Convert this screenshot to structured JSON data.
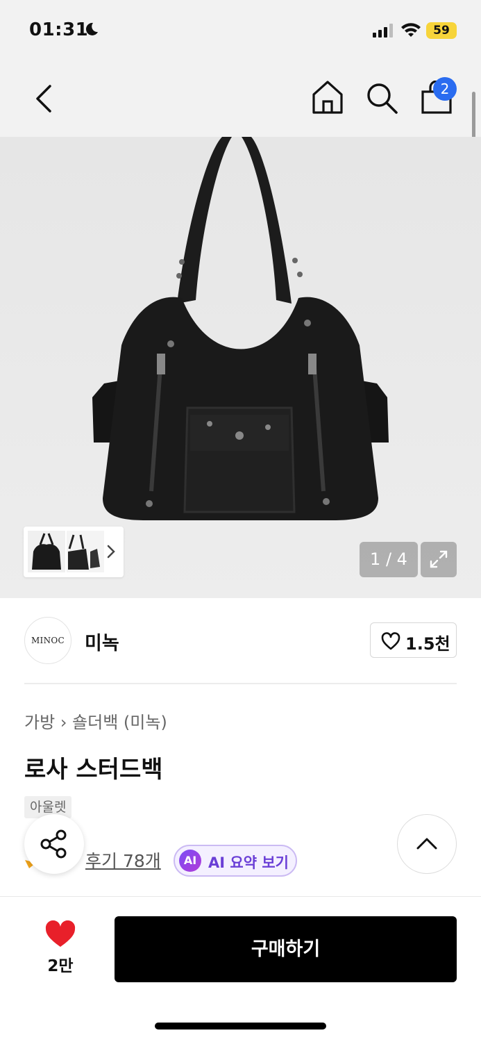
{
  "status_bar": {
    "time": "01:31",
    "battery": "59"
  },
  "header": {
    "cart_count": "2"
  },
  "gallery": {
    "pager": "1 / 4"
  },
  "brand": {
    "logo_text": "MINOC",
    "name": "미녹",
    "likes": "1.5천"
  },
  "product": {
    "breadcrumb_category": "가방",
    "breadcrumb_sub": "숄더백 (미녹)",
    "title": "로사 스터드백",
    "tag": "아울렛",
    "review_link": "후기 78개",
    "ai_badge": "AI",
    "ai_summary": "AI 요약 보기"
  },
  "bottom_bar": {
    "wish_count": "2만",
    "buy_label": "구매하기"
  },
  "colors": {
    "accent_blue": "#2a6cf0",
    "heart_red": "#e8202a",
    "ai_purple": "#6a3fd6"
  }
}
